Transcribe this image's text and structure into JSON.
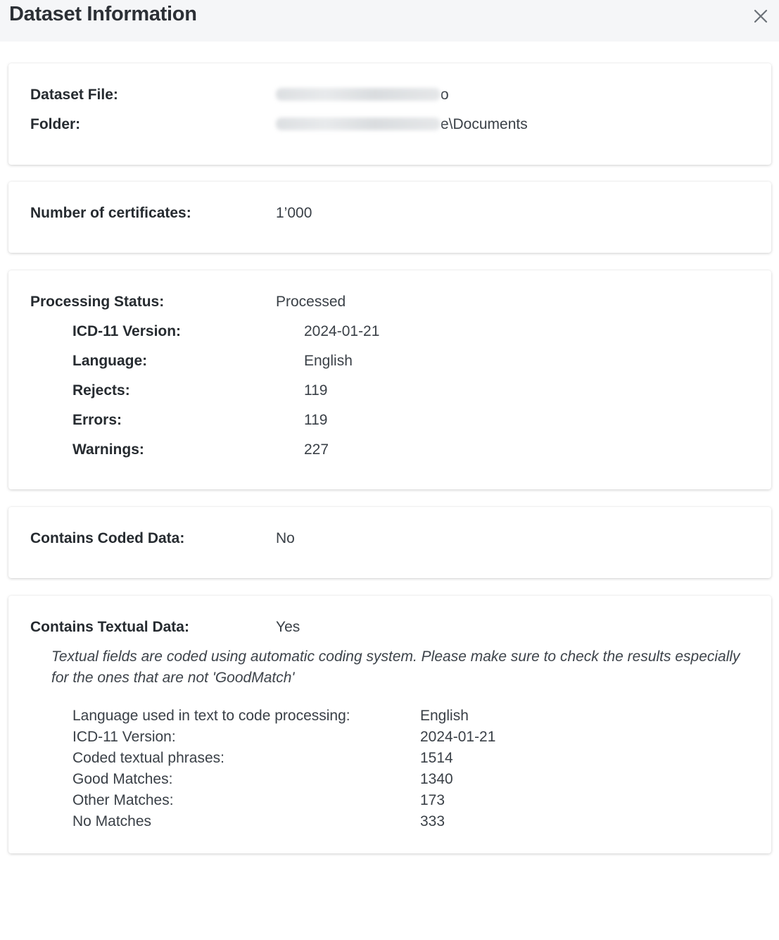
{
  "dialog": {
    "title": "Dataset Information"
  },
  "file_card": {
    "dataset_file_label": "Dataset File:",
    "dataset_file_value_tail": "o",
    "folder_label": "Folder:",
    "folder_value_tail": "e\\Documents"
  },
  "certificates_card": {
    "label": "Number of certificates:",
    "value": "1’000"
  },
  "processing_card": {
    "label": "Processing Status:",
    "value": "Processed",
    "details": [
      {
        "label": "ICD-11 Version:",
        "value": "2024-01-21"
      },
      {
        "label": "Language:",
        "value": "English"
      },
      {
        "label": "Rejects:",
        "value": "119"
      },
      {
        "label": "Errors:",
        "value": "119"
      },
      {
        "label": "Warnings:",
        "value": "227"
      }
    ]
  },
  "coded_card": {
    "label": "Contains Coded Data:",
    "value": "No"
  },
  "textual_card": {
    "label": "Contains Textual Data:",
    "value": "Yes",
    "note": "Textual fields are coded using automatic coding system. Please make sure to check the results especially for the ones that are not 'GoodMatch'",
    "details": [
      {
        "label": "Language used in text to code processing:",
        "value": "English"
      },
      {
        "label": "ICD-11 Version:",
        "value": "2024-01-21"
      },
      {
        "label": "Coded textual phrases:",
        "value": "1514"
      },
      {
        "label": "Good Matches:",
        "value": "1340"
      },
      {
        "label": "Other Matches:",
        "value": "173"
      },
      {
        "label": "No Matches",
        "value": "333"
      }
    ]
  },
  "colors": {
    "header_bg": "#f5f6f8",
    "text": "#333a40"
  }
}
